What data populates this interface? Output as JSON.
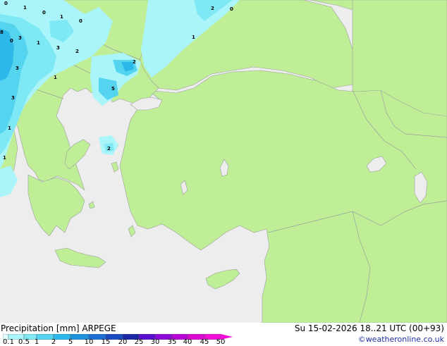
{
  "map": {
    "precip_labels": [
      "0",
      "1",
      "0",
      "1",
      "0",
      "2",
      "0",
      "8",
      "3",
      "1",
      "3",
      "2",
      "0",
      "1",
      "3",
      "1",
      "5",
      "3",
      "1",
      "2",
      "1"
    ]
  },
  "footer": {
    "title": "Precipitation [mm]  ARPEGE",
    "datetime": "Su 15-02-2026 18..21 UTC (00+93)",
    "credit": "©weatheronline.co.uk",
    "scale_labels": [
      "0.1",
      "0.5",
      "1",
      "2",
      "5",
      "10",
      "15",
      "20",
      "25",
      "30",
      "35",
      "40",
      "45",
      "50"
    ],
    "scale_colors": [
      "#e0fdfd",
      "#a9f5f9",
      "#7ee8f5",
      "#55d4f0",
      "#2cb8e8",
      "#1f92dd",
      "#1d6fd4",
      "#1b4bc3",
      "#1a2aa6",
      "#5a0fd0",
      "#8c0ad8",
      "#b806d8",
      "#d80ad0",
      "#f20ed8"
    ]
  }
}
